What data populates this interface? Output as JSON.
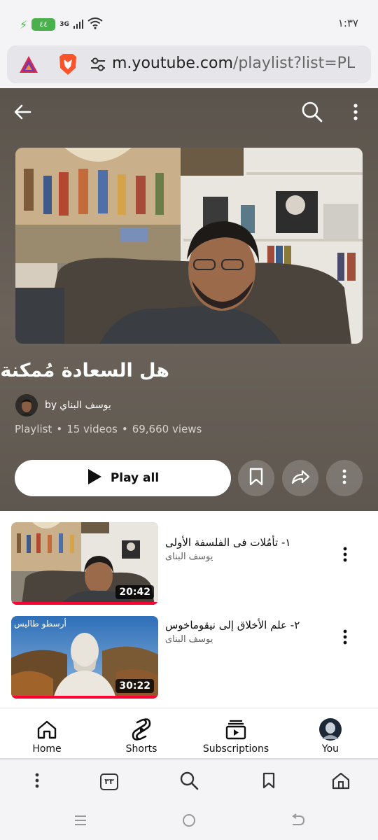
{
  "status_bar": {
    "battery": "٤٤",
    "network": "3G",
    "time": "١:٣٧"
  },
  "browser": {
    "url_domain": "m.youtube.com",
    "url_path": "/playlist?list=PL",
    "tab_count": "٣٣"
  },
  "playlist": {
    "title": "هل السعادة مُمكنة؟",
    "by_label": "by",
    "channel": "يوسف البناي",
    "type": "Playlist",
    "videos": "15 videos",
    "views": "69,660 views",
    "play_all_label": "Play all"
  },
  "videos": [
    {
      "title": "١- تأمُلات فى الفلسفة الأولى",
      "channel": "يوسف البناى",
      "duration": "20:42",
      "progress": 1.0
    },
    {
      "title": "٢- علم الأخلاق إلى نيقوماخوس",
      "channel": "يوسف البناى",
      "duration": "30:22",
      "overlay_text": "أرسطو طاليس",
      "progress": 1.0
    }
  ],
  "nav": {
    "home": "Home",
    "shorts": "Shorts",
    "subscriptions": "Subscriptions",
    "you": "You"
  },
  "colors": {
    "header_bg": "#5e574f",
    "accent_red": "#ff0033",
    "battery_green": "#49b04b",
    "brave_orange": "#fb542b"
  },
  "icons": {
    "back": "arrow-left-icon",
    "search": "search-icon",
    "more": "more-vert-icon",
    "save": "bookmark-icon",
    "share": "share-icon"
  }
}
